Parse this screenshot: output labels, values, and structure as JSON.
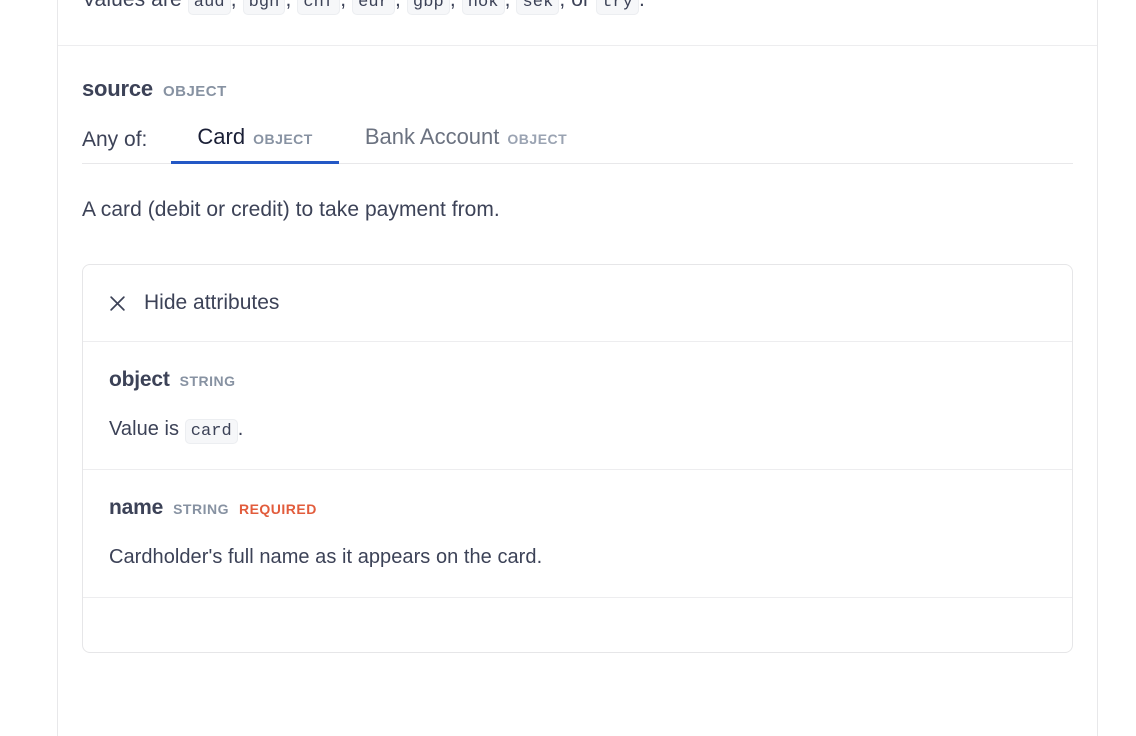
{
  "previous_section": {
    "text_before": "Values are",
    "tokens": [
      "aud",
      "bgn",
      "chf",
      "eur",
      "gbp",
      "nok",
      "sek"
    ],
    "conjunction": "or",
    "last_token": "try",
    "text_after": "."
  },
  "field": {
    "name": "source",
    "type": "OBJECT"
  },
  "any_of": {
    "label": "Any of:",
    "tabs": [
      {
        "label": "Card",
        "type": "OBJECT",
        "active": true
      },
      {
        "label": "Bank Account",
        "type": "OBJECT",
        "active": false
      }
    ]
  },
  "description": "A card (debit or credit) to take payment from.",
  "attributes_card": {
    "toggle_label": "Hide attributes",
    "toggle_icon": "close-icon",
    "rows": [
      {
        "name": "object",
        "type": "STRING",
        "required": "",
        "desc_before": "Value is",
        "desc_code": "card",
        "desc_after": "."
      },
      {
        "name": "name",
        "type": "STRING",
        "required": "REQUIRED",
        "desc_before": "Cardholder's full name as it appears on the card.",
        "desc_code": "",
        "desc_after": ""
      }
    ]
  },
  "colors": {
    "accent_blue": "#2358c5",
    "required_orange": "#e25c3c",
    "text_primary": "#3c4257",
    "text_muted": "#8792a2",
    "border": "#e6e6e8",
    "code_bg": "#f6f7f9"
  }
}
